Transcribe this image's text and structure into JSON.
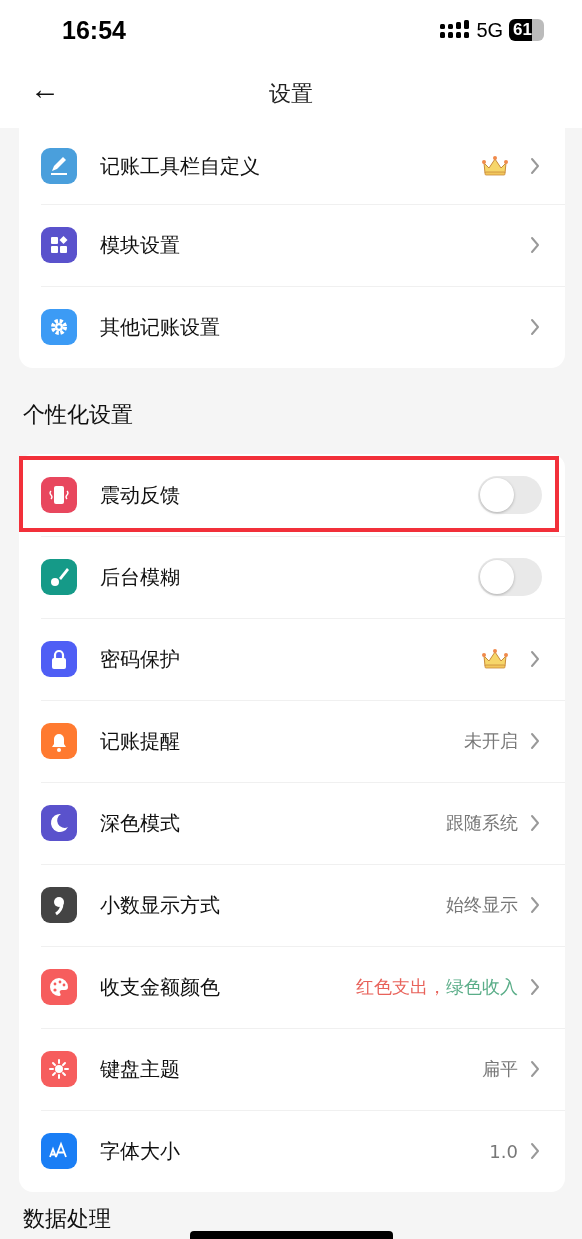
{
  "status_bar": {
    "time": "16:54",
    "network": "5G",
    "battery": "61"
  },
  "nav": {
    "back": "←",
    "title": "设置"
  },
  "groups": [
    {
      "rows": [
        {
          "label": "记账工具栏自定义",
          "color": "#4a9fdc",
          "kind": "link",
          "premium": true,
          "highlighted": false
        },
        {
          "label": "模块设置",
          "color": "#5a52cc",
          "kind": "link",
          "premium": false,
          "highlighted": false
        },
        {
          "label": "其他记账设置",
          "color": "#3c9bf5",
          "kind": "link",
          "premium": false,
          "highlighted": false
        }
      ]
    },
    {
      "title": "个性化设置",
      "rows": [
        {
          "label": "震动反馈",
          "color": "#e8475e",
          "kind": "toggle",
          "on": false,
          "highlighted": true
        },
        {
          "label": "后台模糊",
          "color": "#159a88",
          "kind": "toggle",
          "on": false,
          "highlighted": false
        },
        {
          "label": "密码保护",
          "color": "#4f5ef5",
          "kind": "link",
          "premium": true,
          "highlighted": false
        },
        {
          "label": "记账提醒",
          "color": "#ff7a30",
          "kind": "link",
          "premium": false,
          "highlighted": false,
          "value_parts": [
            {
              "text": "未开启",
              "color": "#777777"
            }
          ]
        },
        {
          "label": "深色模式",
          "color": "#5a52cc",
          "kind": "link",
          "premium": false,
          "highlighted": false,
          "value_parts": [
            {
              "text": "跟随系统",
              "color": "#777777"
            }
          ]
        },
        {
          "label": "小数显示方式",
          "color": "#444444",
          "kind": "link",
          "premium": false,
          "highlighted": false,
          "value_parts": [
            {
              "text": "始终显示",
              "color": "#777777"
            }
          ]
        },
        {
          "label": "收支金额颜色",
          "color": "#f65d5d",
          "kind": "link",
          "premium": false,
          "highlighted": false,
          "value_parts": [
            {
              "text": "红色支出，",
              "color": "#e8625a"
            },
            {
              "text": "绿色收入",
              "color": "#5aad88"
            }
          ]
        },
        {
          "label": "键盘主题",
          "color": "#f65d5d",
          "kind": "link",
          "premium": false,
          "highlighted": false,
          "value_parts": [
            {
              "text": "扁平",
              "color": "#777777"
            }
          ]
        },
        {
          "label": "字体大小",
          "color": "#1a7ef5",
          "kind": "link",
          "premium": false,
          "highlighted": false,
          "value_parts": [
            {
              "text": "1.0",
              "color": "#777777"
            }
          ]
        }
      ]
    },
    {
      "title": "数据处理"
    }
  ]
}
